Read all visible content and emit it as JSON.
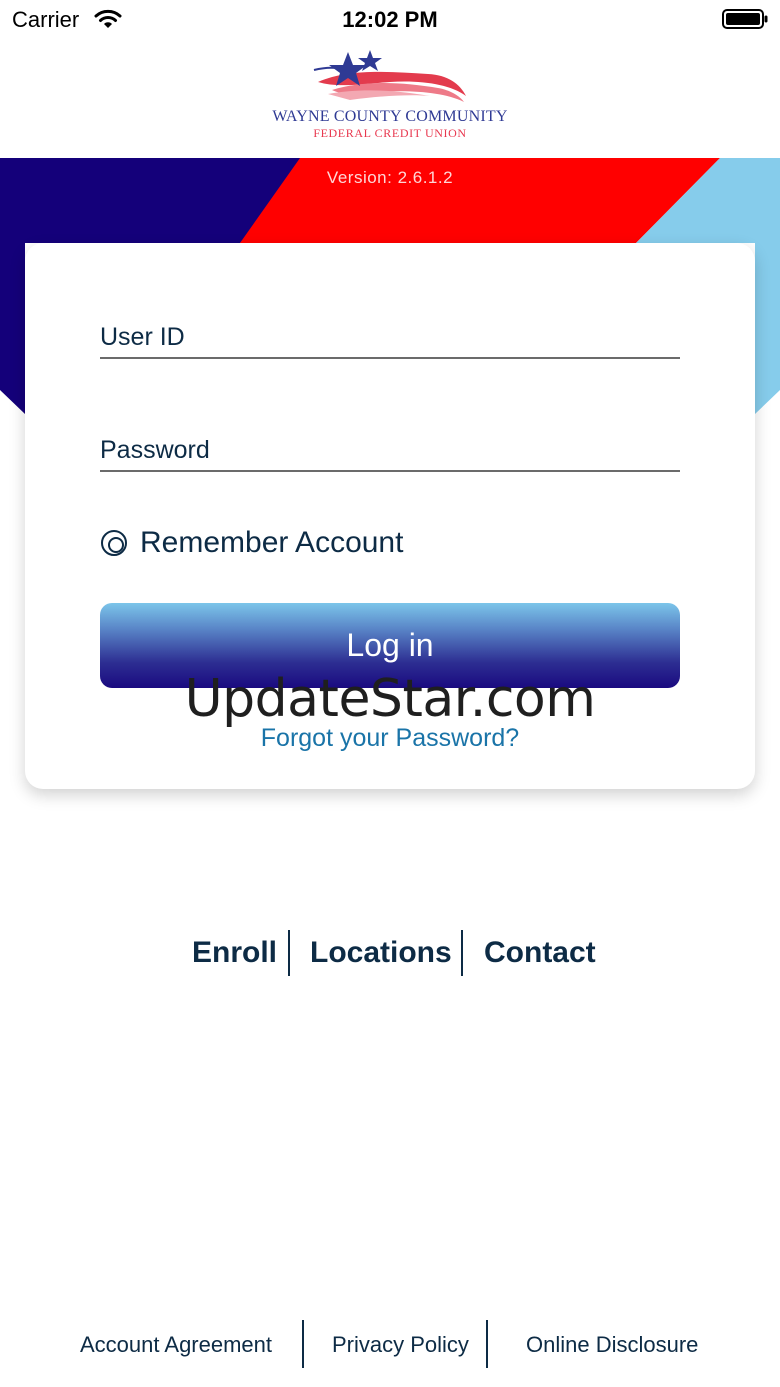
{
  "status_bar": {
    "carrier": "Carrier",
    "time": "12:02 PM",
    "wifi_icon": "wifi-icon",
    "battery_icon": "battery-icon"
  },
  "logo": {
    "line1": "WAYNE COUNTY COMMUNITY",
    "line2": "FEDERAL CREDIT UNION",
    "icon": "flag-stars-logo"
  },
  "banner": {
    "version": "Version: 2.6.1.2",
    "colors": {
      "navy": "#14007a",
      "red": "#ff0000",
      "light_blue": "#86cceb"
    }
  },
  "login_form": {
    "user_id_placeholder": "User ID",
    "password_placeholder": "Password",
    "remember_label": "Remember Account",
    "remember_checked": false,
    "login_button": "Log in",
    "forgot_password": "Forgot your Password?"
  },
  "watermark": "UpdateStar.com",
  "links": {
    "enroll": "Enroll",
    "locations": "Locations",
    "contact": "Contact"
  },
  "footer": {
    "account_agreement": "Account Agreement",
    "privacy_policy": "Privacy Policy",
    "online_disclosure": "Online Disclosure"
  }
}
